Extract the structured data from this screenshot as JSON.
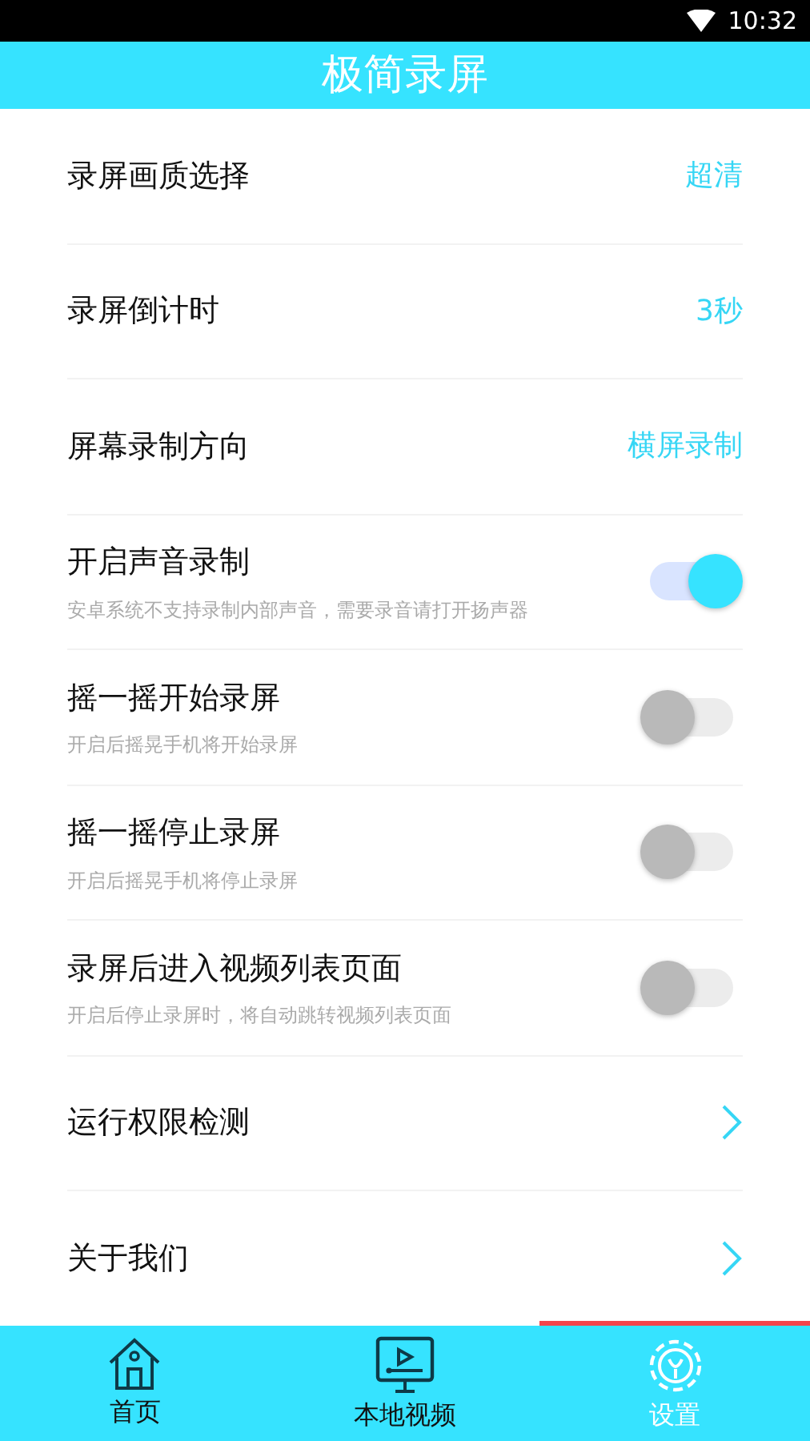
{
  "status_bar": {
    "time": "10:32"
  },
  "header": {
    "title": "极简录屏"
  },
  "settings": [
    {
      "kind": "value",
      "label": "录屏画质选择",
      "value": "超清"
    },
    {
      "kind": "value",
      "label": "录屏倒计时",
      "value": "3秒"
    },
    {
      "kind": "value",
      "label": "屏幕录制方向",
      "value": "横屏录制"
    },
    {
      "kind": "toggle",
      "label": "开启声音录制",
      "hint": "安卓系统不支持录制内部声音，需要录音请打开扬声器",
      "on": true
    },
    {
      "kind": "toggle",
      "label": "摇一摇开始录屏",
      "hint": "开启后摇晃手机将开始录屏",
      "on": false
    },
    {
      "kind": "toggle",
      "label": "摇一摇停止录屏",
      "hint": "开启后摇晃手机将停止录屏",
      "on": false
    },
    {
      "kind": "toggle",
      "label": "录屏后进入视频列表页面",
      "hint": "开启后停止录屏时，将自动跳转视频列表页面",
      "on": false
    },
    {
      "kind": "link",
      "label": "运行权限检测"
    },
    {
      "kind": "link",
      "label": "关于我们"
    }
  ],
  "bottom_nav": [
    {
      "kind": "home",
      "label": "首页",
      "selected": false
    },
    {
      "kind": "video",
      "label": "本地视频",
      "selected": false
    },
    {
      "kind": "settings",
      "label": "设置",
      "selected": true
    }
  ]
}
